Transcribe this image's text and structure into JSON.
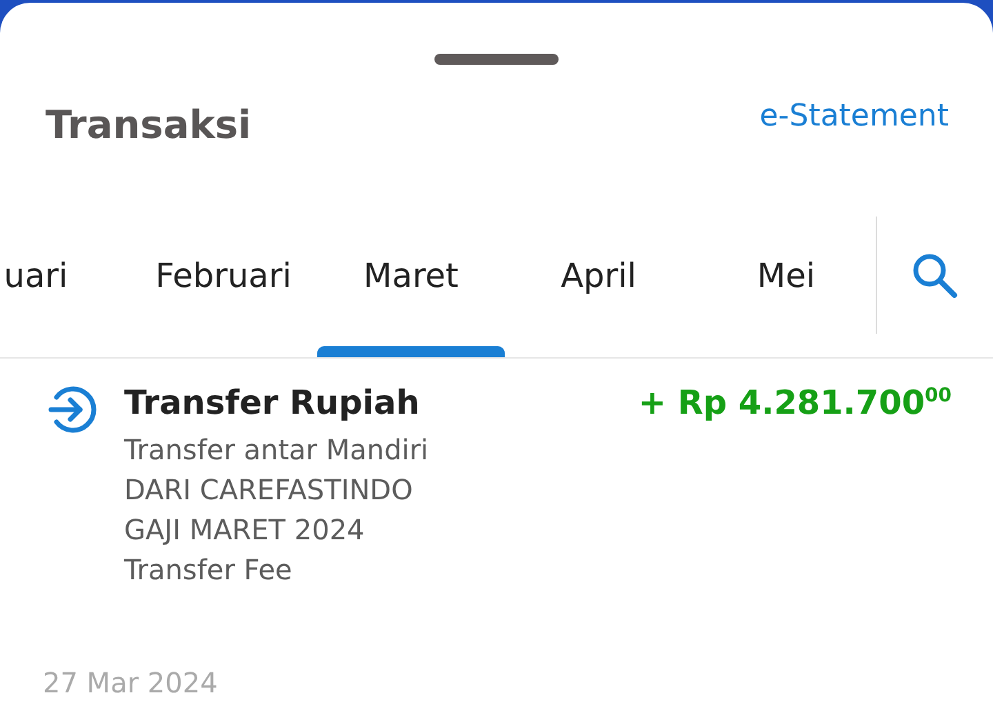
{
  "header": {
    "title": "Transaksi",
    "link": "e-Statement"
  },
  "tabs": [
    {
      "label": "uari",
      "selected": false
    },
    {
      "label": "Februari",
      "selected": false
    },
    {
      "label": "Maret",
      "selected": true
    },
    {
      "label": "April",
      "selected": false
    },
    {
      "label": "Mei",
      "selected": false
    }
  ],
  "transactions": [
    {
      "kind": "incoming",
      "title": "Transfer Rupiah",
      "amount": "+ Rp 4.281.700$^{00}$",
      "details": [
        "Transfer antar Mandiri",
        "DARI CAREFASTINDO",
        "GAJI MARET 2024",
        "Transfer Fee"
      ]
    }
  ],
  "next_date": "27 Mar 2024"
}
